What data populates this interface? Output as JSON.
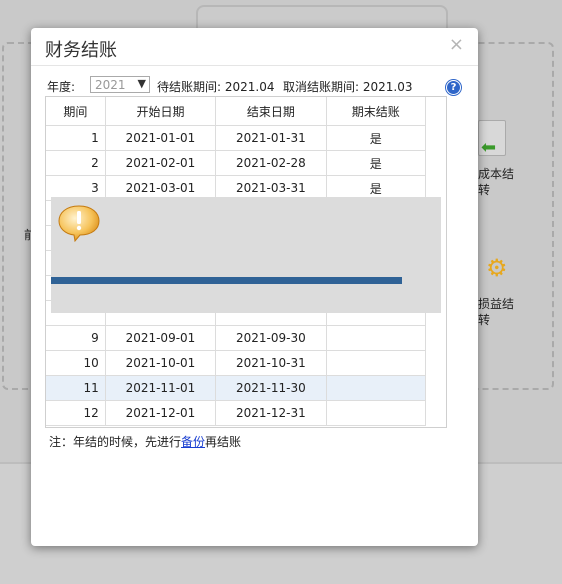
{
  "background": {
    "side_label_left": "前",
    "label_right_1_line1": "成本结",
    "label_right_1_line2": "转",
    "label_right_2_line1": "损益结",
    "label_right_2_line2": "转"
  },
  "dialog": {
    "title": "财务结账",
    "close_glyph": "×",
    "year_label": "年度:",
    "year_value": "2021",
    "pending_label": "待结账期间: 2021.04",
    "cancel_label": "取消结账期间: 2021.03",
    "help_glyph": "?",
    "table": {
      "headers": [
        "期间",
        "开始日期",
        "结束日期",
        "期末结账"
      ],
      "rows": [
        {
          "period": "1",
          "start": "2021-01-01",
          "end": "2021-01-31",
          "closed": "是"
        },
        {
          "period": "2",
          "start": "2021-02-01",
          "end": "2021-02-28",
          "closed": "是"
        },
        {
          "period": "3",
          "start": "2021-03-01",
          "end": "2021-03-31",
          "closed": "是"
        },
        {
          "period": "",
          "start": "",
          "end": "",
          "closed": ""
        },
        {
          "period": "",
          "start": "",
          "end": "",
          "closed": ""
        },
        {
          "period": "",
          "start": "",
          "end": "",
          "closed": ""
        },
        {
          "period": "",
          "start": "",
          "end": "",
          "closed": ""
        },
        {
          "period": "",
          "start": "",
          "end": "",
          "closed": ""
        },
        {
          "period": "9",
          "start": "2021-09-01",
          "end": "2021-09-30",
          "closed": ""
        },
        {
          "period": "10",
          "start": "2021-10-01",
          "end": "2021-10-31",
          "closed": ""
        },
        {
          "period": "11",
          "start": "2021-11-01",
          "end": "2021-11-30",
          "closed": ""
        },
        {
          "period": "12",
          "start": "2021-12-01",
          "end": "2021-12-31",
          "closed": ""
        }
      ]
    },
    "note_prefix": "注：年结的时候，先进行",
    "note_link": "备份",
    "note_suffix": "再结账",
    "progress_fraction": 0.9
  },
  "colors": {
    "accent": "#2f6296",
    "link": "#1a3fd1",
    "selected_row": "#e8f0f9"
  },
  "icons": [
    "warning-bubble-icon",
    "help-icon",
    "close-icon",
    "dropdown-arrow-icon",
    "gear-icon",
    "green-arrow-icon"
  ]
}
